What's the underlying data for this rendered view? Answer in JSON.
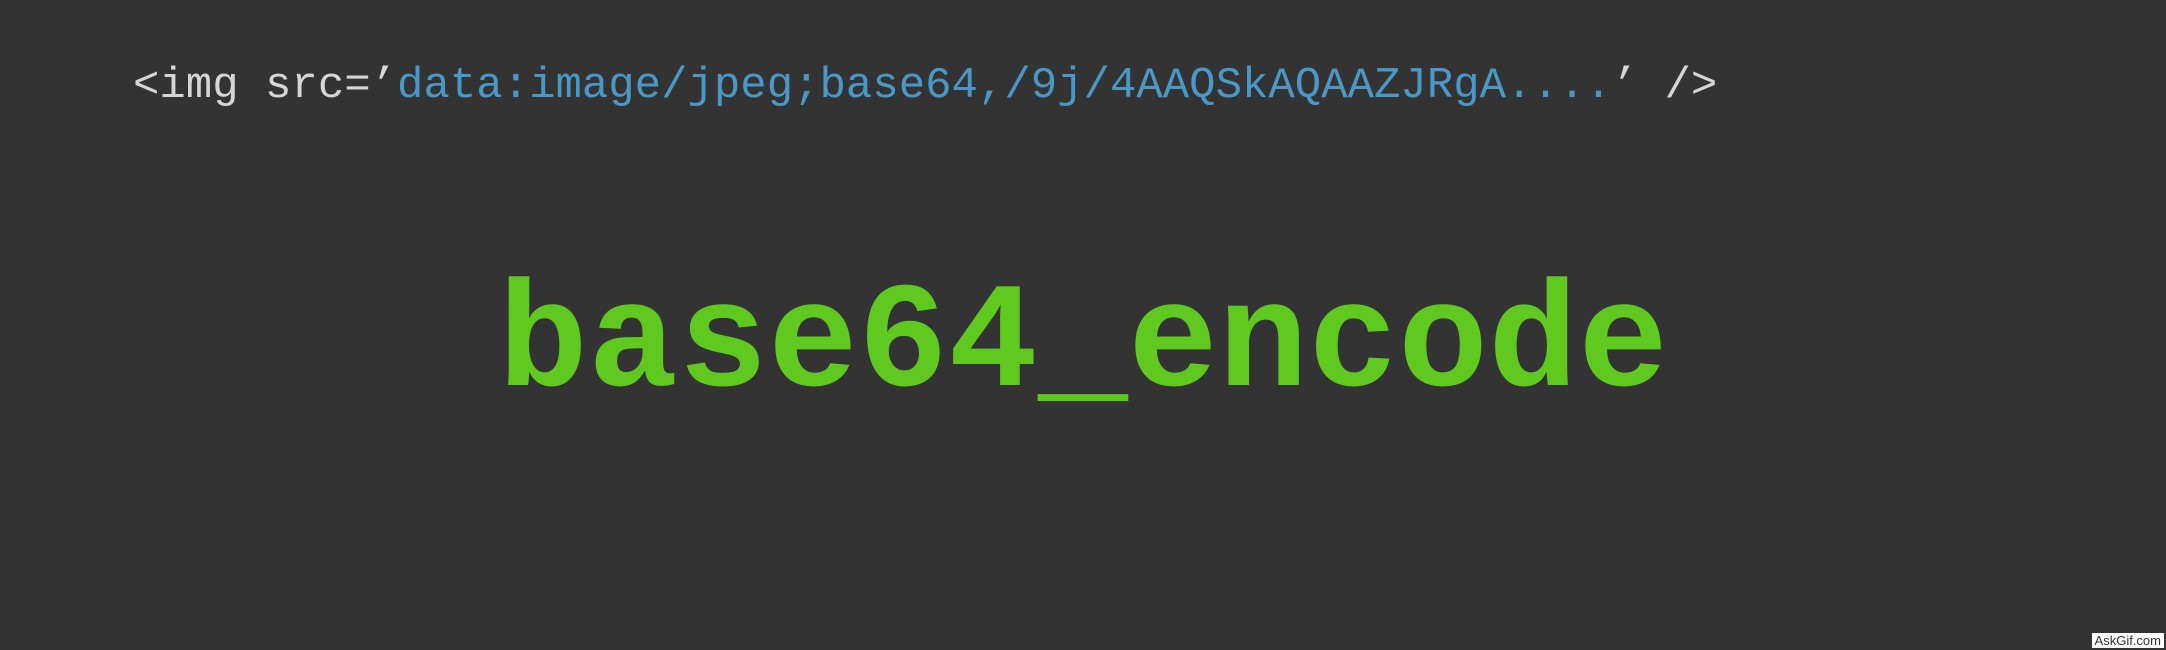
{
  "code": {
    "prefix": "<img src=’",
    "value": "data:image/jpeg;base64,/9j/4AAQSkAQAAZJRgA....",
    "suffix": "’ />"
  },
  "title": "base64_encode",
  "watermark": "AskGif.com",
  "colors": {
    "background": "#333333",
    "code_plain": "#d6d6d6",
    "code_string": "#4a98c6",
    "title": "#5fc91f"
  }
}
